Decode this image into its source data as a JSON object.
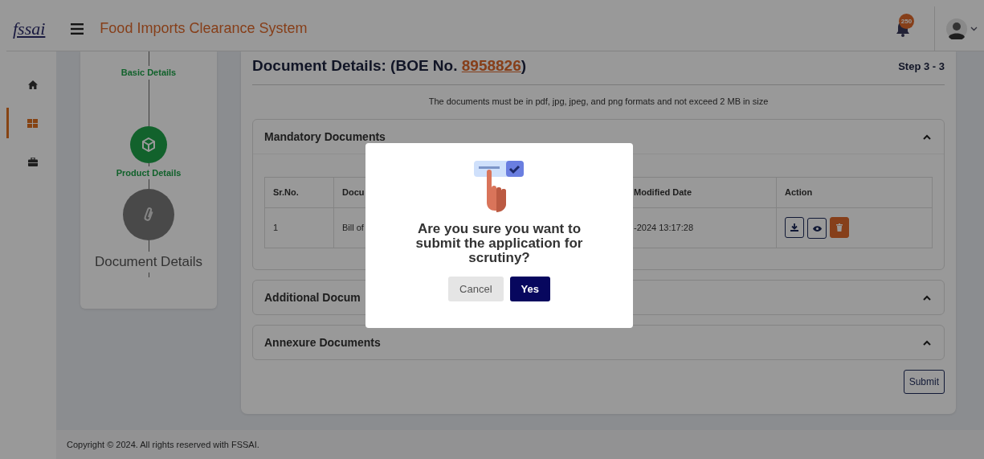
{
  "header": {
    "logo": "fssai",
    "title": "Food Imports Clearance System",
    "notification_count": "250"
  },
  "sidebar": {
    "items": [
      {
        "kind": "home",
        "selected": false
      },
      {
        "kind": "grid",
        "selected": true
      },
      {
        "kind": "briefcase",
        "selected": false
      }
    ]
  },
  "stepper": [
    {
      "label": "Basic Details",
      "completed": true
    },
    {
      "label": "Product Details",
      "completed": true
    },
    {
      "label": "Document Details",
      "completed": false
    }
  ],
  "document": {
    "title": "Document Details: (BOE No. ",
    "boe_no": "8958826",
    "title_end": ")",
    "step": "Step 3 - 3",
    "note": "The documents must be in pdf, jpg, jpeg, and png formats and not exceed 2 MB in size"
  },
  "accordions": [
    {
      "title": "Mandatory Documents",
      "expanded": true,
      "table": {
        "columns": [
          "Sr.No.",
          "Docu",
          "Modified Date",
          "Action"
        ],
        "rows": [
          {
            "cells": [
              "1",
              "Bill of",
              "-2024 13:17:28"
            ],
            "actions": [
              {
                "kind": "download"
              },
              {
                "kind": "view"
              },
              {
                "kind": "delete"
              }
            ]
          }
        ]
      }
    },
    {
      "title": "Additional Docum",
      "expanded": true
    },
    {
      "title": "Annexure Documents",
      "expanded": true
    }
  ],
  "submit_button": "Submit",
  "footer": "Copyright © 2024. All rights reserved with FSSAI.",
  "modal": {
    "message": "Are you sure you want to submit the application for scrutiny?",
    "buttons": [
      {
        "label": "Cancel",
        "kind": "secondary"
      },
      {
        "label": "Yes",
        "kind": "primary"
      }
    ]
  }
}
